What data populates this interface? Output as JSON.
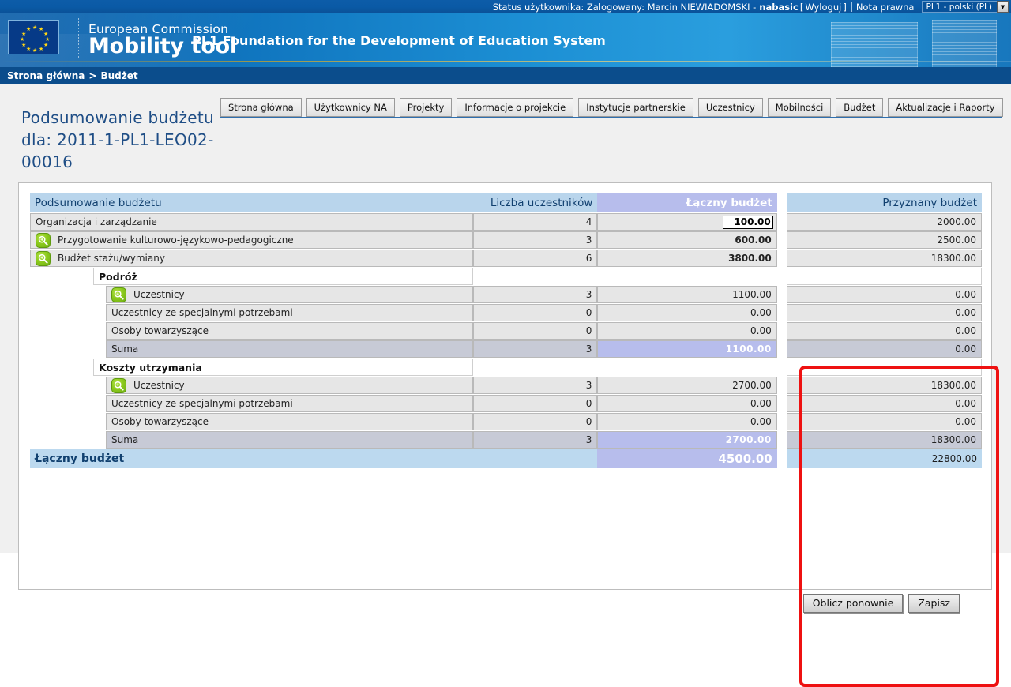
{
  "statusbar": {
    "status_text": "Status użytkownika: Zalogowany: Marcin NIEWIADOMSKI -",
    "username": "nabasic",
    "bracket_open": "[",
    "logout": "Wyloguj",
    "bracket_close": "]",
    "legal": "Nota prawna",
    "language_selected": "PL1 - polski (PL)"
  },
  "banner": {
    "brand_line1": "European Commission",
    "brand_line2": "Mobility tool",
    "org_title": "PL1 Foundation for the Development of Education System"
  },
  "breadcrumb": {
    "home": "Strona główna",
    "separator": ">",
    "current": "Budżet"
  },
  "page": {
    "title": "Podsumowanie budżetu dla: 2011-1-PL1-LEO02-00016"
  },
  "tabs": [
    {
      "label": "Strona główna"
    },
    {
      "label": "Użytkownicy NA"
    },
    {
      "label": "Projekty"
    },
    {
      "label": "Informacje o projekcie"
    },
    {
      "label": "Instytucje partnerskie"
    },
    {
      "label": "Uczestnicy"
    },
    {
      "label": "Mobilności"
    },
    {
      "label": "Budżet"
    },
    {
      "label": "Aktualizacje i Raporty"
    }
  ],
  "table": {
    "headers": {
      "label": "Podsumowanie budżetu",
      "count": "Liczba uczestników",
      "total": "Łączny budżet",
      "grant": "Przyznany budżet"
    },
    "rows": [
      {
        "kind": "item",
        "indent": 1,
        "icon": false,
        "label": "Organizacja i zarządzanie",
        "count": "4",
        "total": "100.00",
        "total_input": true,
        "grant": "2000.00"
      },
      {
        "kind": "item",
        "indent": 1,
        "icon": true,
        "label": "Przygotowanie kulturowo-językowo-pedagogiczne",
        "count": "3",
        "total": "600.00",
        "total_bold": true,
        "grant": "2500.00"
      },
      {
        "kind": "item",
        "indent": 1,
        "icon": true,
        "label": "Budżet stażu/wymiany",
        "count": "6",
        "total": "3800.00",
        "total_bold": true,
        "grant": "18300.00"
      },
      {
        "kind": "section",
        "indent": 2,
        "label": "Podróż"
      },
      {
        "kind": "item",
        "indent": 3,
        "icon": true,
        "label": "Uczestnicy",
        "count": "3",
        "total": "1100.00",
        "grant": "0.00"
      },
      {
        "kind": "item",
        "indent": 3,
        "icon": false,
        "label": "Uczestnicy ze specjalnymi potrzebami",
        "count": "0",
        "total": "0.00",
        "grant": "0.00"
      },
      {
        "kind": "item",
        "indent": 3,
        "icon": false,
        "label": "Osoby towarzyszące",
        "count": "0",
        "total": "0.00",
        "grant": "0.00"
      },
      {
        "kind": "sum",
        "indent": 3,
        "icon": false,
        "label": "Suma",
        "count": "3",
        "total": "1100.00",
        "grant": "0.00"
      },
      {
        "kind": "section",
        "indent": 2,
        "label": "Koszty utrzymania"
      },
      {
        "kind": "item",
        "indent": 3,
        "icon": true,
        "label": "Uczestnicy",
        "count": "3",
        "total": "2700.00",
        "grant": "18300.00"
      },
      {
        "kind": "item",
        "indent": 3,
        "icon": false,
        "label": "Uczestnicy ze specjalnymi potrzebami",
        "count": "0",
        "total": "0.00",
        "grant": "0.00"
      },
      {
        "kind": "item",
        "indent": 3,
        "icon": false,
        "label": "Osoby towarzyszące",
        "count": "0",
        "total": "0.00",
        "grant": "0.00"
      },
      {
        "kind": "sum",
        "indent": 3,
        "icon": false,
        "label": "Suma",
        "count": "3",
        "total": "2700.00",
        "grant": "18300.00"
      },
      {
        "kind": "grand",
        "indent": 1,
        "icon": false,
        "label": "Łączny budżet",
        "count": "",
        "total": "4500.00",
        "grant": "22800.00"
      }
    ]
  },
  "footer": {
    "recalculate": "Oblicz ponownie",
    "save": "Zapisz"
  },
  "colors": {
    "banner_blue": "#1c8fd4",
    "breadcrumb_blue": "#0b4d8c",
    "title_blue": "#1f4e86",
    "header_blue": "#b9d5ec",
    "accent_lavender": "#b7bdec",
    "sum_grey": "#c7cad6",
    "cell_grey": "#e6e6e6",
    "annotation_red": "#ee1111",
    "icon_green": "#8dcb1e"
  }
}
